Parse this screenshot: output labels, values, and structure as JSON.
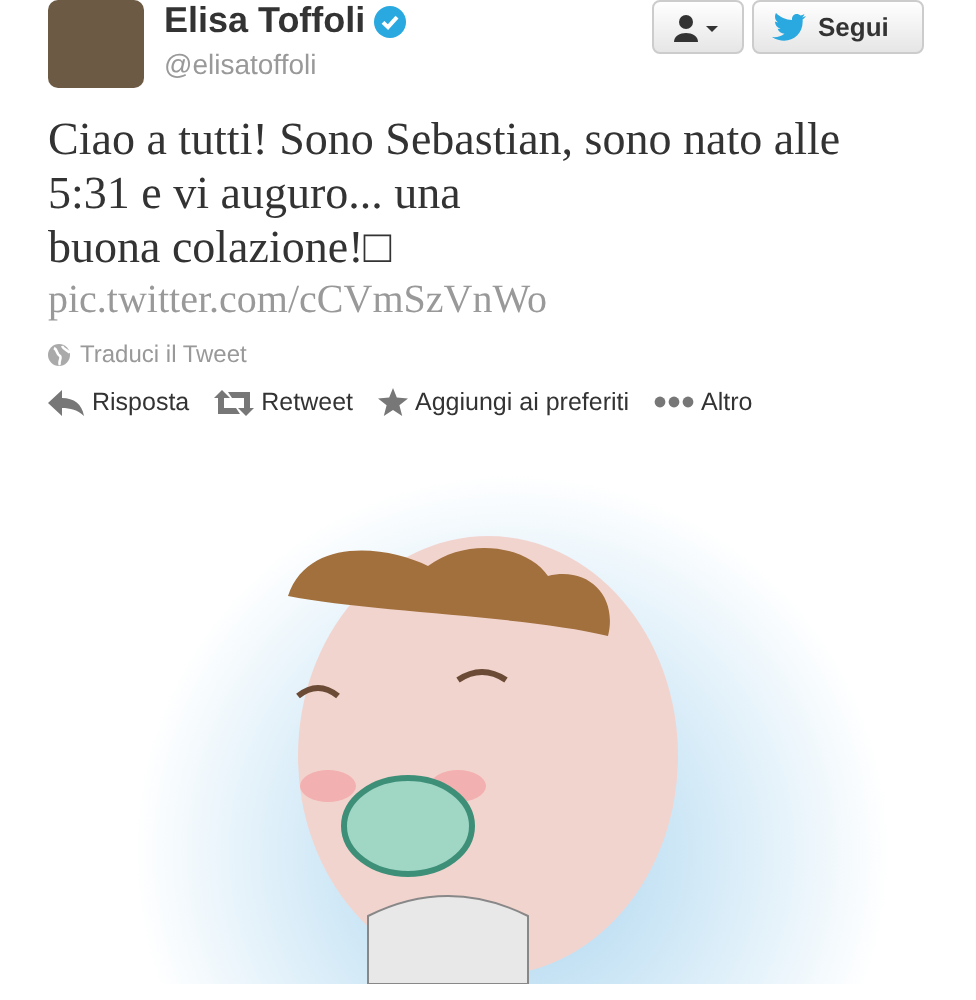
{
  "author": {
    "name": "Elisa Toffoli",
    "verified": true,
    "handle": "@elisatoffoli"
  },
  "follow_button": {
    "label": "Segui"
  },
  "tweet_text": "Ciao a tutti! Sono Sebastian, sono nato alle 5:31 e vi auguro... una\nbuona colazione!□",
  "link": "pic.twitter.com/cCVmSzVnWo",
  "translate": "Traduci il Tweet",
  "actions": [
    {
      "kind": "reply",
      "label": "Risposta"
    },
    {
      "kind": "retweet",
      "label": "Retweet"
    },
    {
      "kind": "favorite",
      "label": "Aggiungi ai preferiti"
    },
    {
      "kind": "more",
      "label": "Altro"
    }
  ]
}
